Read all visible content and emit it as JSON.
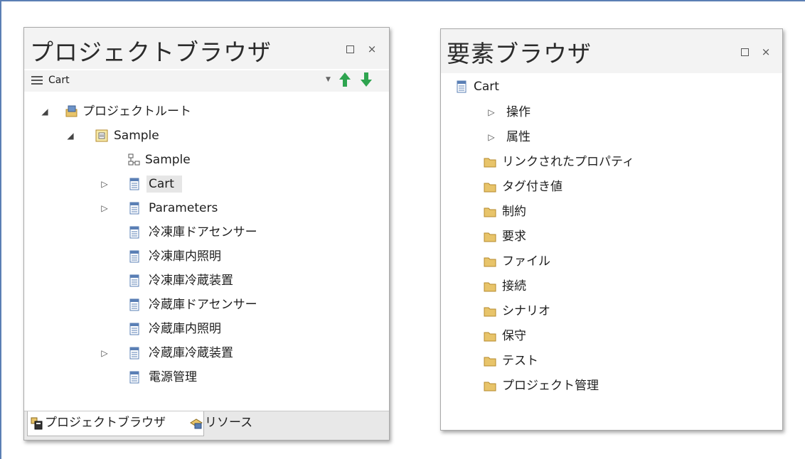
{
  "project_browser": {
    "title": "プロジェクトブラウザ",
    "context_label": "Cart",
    "tree": [
      {
        "label": "プロジェクトルート",
        "icon": "project-root-icon",
        "expander": "◢"
      },
      {
        "label": "Sample",
        "icon": "package-icon",
        "expander": "◢"
      },
      {
        "label": "Sample",
        "icon": "diagram-icon",
        "expander": ""
      },
      {
        "label": "Cart",
        "icon": "block-icon",
        "expander": "▷"
      },
      {
        "label": "Parameters",
        "icon": "block-icon",
        "expander": "▷"
      },
      {
        "label": "冷凍庫ドアセンサー",
        "icon": "block-icon",
        "expander": ""
      },
      {
        "label": "冷凍庫内照明",
        "icon": "block-icon",
        "expander": ""
      },
      {
        "label": "冷凍庫冷蔵装置",
        "icon": "block-icon",
        "expander": ""
      },
      {
        "label": "冷蔵庫ドアセンサー",
        "icon": "block-icon",
        "expander": ""
      },
      {
        "label": "冷蔵庫内照明",
        "icon": "block-icon",
        "expander": ""
      },
      {
        "label": "冷蔵庫冷蔵装置",
        "icon": "block-icon",
        "expander": "▷"
      },
      {
        "label": "電源管理",
        "icon": "block-icon",
        "expander": ""
      }
    ],
    "tabs": [
      {
        "label": "プロジェクトブラウザ",
        "icon": "project-browser-icon"
      },
      {
        "label": "リソース",
        "icon": "resources-icon"
      }
    ]
  },
  "element_browser": {
    "title": "要素ブラウザ",
    "tree": [
      {
        "label": "Cart",
        "icon": "block-icon",
        "expander": ""
      },
      {
        "label": "操作",
        "icon": "",
        "expander": "▷"
      },
      {
        "label": "属性",
        "icon": "",
        "expander": "▷"
      },
      {
        "label": "リンクされたプロパティ",
        "icon": "folder-icon",
        "expander": ""
      },
      {
        "label": "タグ付き値",
        "icon": "folder-icon",
        "expander": ""
      },
      {
        "label": "制約",
        "icon": "folder-icon",
        "expander": ""
      },
      {
        "label": "要求",
        "icon": "folder-icon",
        "expander": ""
      },
      {
        "label": "ファイル",
        "icon": "folder-icon",
        "expander": ""
      },
      {
        "label": "接続",
        "icon": "folder-icon",
        "expander": ""
      },
      {
        "label": "シナリオ",
        "icon": "folder-icon",
        "expander": ""
      },
      {
        "label": "保守",
        "icon": "folder-icon",
        "expander": ""
      },
      {
        "label": "テスト",
        "icon": "folder-icon",
        "expander": ""
      },
      {
        "label": "プロジェクト管理",
        "icon": "folder-icon",
        "expander": ""
      }
    ]
  },
  "window_controls": {
    "restore_icon": "restore-icon",
    "close_glyph": "×"
  },
  "colors": {
    "folder": "#e8c46a",
    "block_icon": "#5a7fb5",
    "arrow_green": "#2ea44f",
    "frame": "#5b7fb4"
  }
}
